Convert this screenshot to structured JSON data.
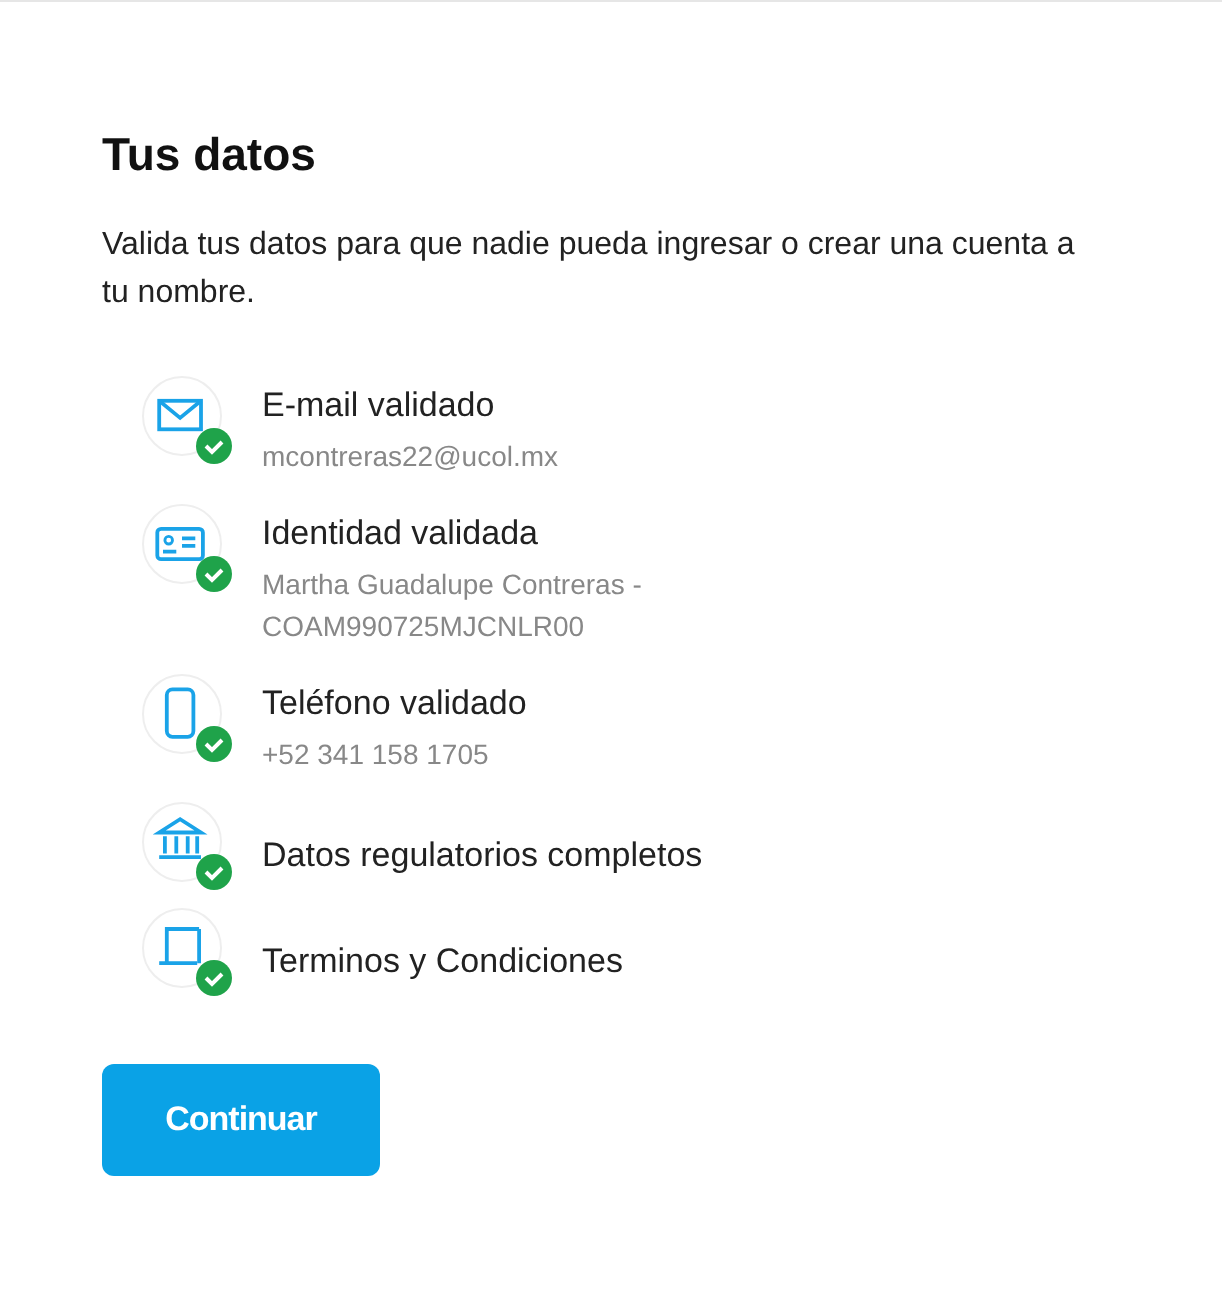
{
  "title": "Tus datos",
  "description": "Valida tus datos para que nadie pueda ingresar o crear una cuenta a tu nombre.",
  "items": [
    {
      "kind": "email",
      "label": "E-mail validado",
      "details": [
        "mcontreras22@ucol.mx"
      ],
      "validated": true
    },
    {
      "kind": "id",
      "label": "Identidad validada",
      "details": [
        "Martha Guadalupe Contreras -",
        "COAM990725MJCNLR00"
      ],
      "validated": true
    },
    {
      "kind": "phone",
      "label": "Teléfono validado",
      "details": [
        "+52 341 158 1705"
      ],
      "validated": true
    },
    {
      "kind": "bank",
      "label": "Datos regulatorios completos",
      "validated": true
    },
    {
      "kind": "document",
      "label": "Terminos y Condiciones",
      "validated": true
    }
  ],
  "button": "Continuar"
}
